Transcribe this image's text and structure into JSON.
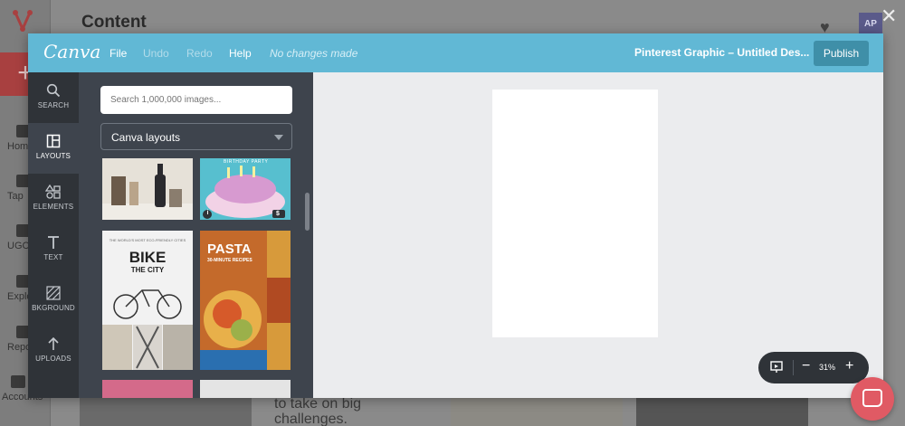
{
  "background": {
    "page_title": "Content",
    "avatar_initials": "AP",
    "nav": [
      "Home",
      "Tap",
      "UGC",
      "Explo",
      "Repo",
      "Accounts"
    ],
    "card_text": "to take on big challenges."
  },
  "editor": {
    "brand": "Canva",
    "menu": {
      "file": "File",
      "undo": "Undo",
      "redo": "Redo",
      "help": "Help"
    },
    "status": "No changes made",
    "doc_title": "Pinterest Graphic – Untitled Des...",
    "publish_label": "Publish",
    "sidebar": [
      {
        "label": "SEARCH",
        "icon": "search-icon"
      },
      {
        "label": "LAYOUTS",
        "icon": "layouts-icon",
        "active": true
      },
      {
        "label": "ELEMENTS",
        "icon": "elements-icon"
      },
      {
        "label": "TEXT",
        "icon": "text-icon"
      },
      {
        "label": "BKGROUND",
        "icon": "background-icon"
      },
      {
        "label": "UPLOADS",
        "icon": "upload-icon"
      }
    ],
    "search_placeholder": "Search 1,000,000 images...",
    "layout_select": "Canva layouts",
    "thumbnails": {
      "bike_kicker": "THE WORLD'S MOST ECO-FRIENDLY CITIES",
      "bike_title1": "BIKE",
      "bike_title2": "THE CITY",
      "pasta_title": "PASTA",
      "pasta_sub": "30-MINUTE RECIPES",
      "birthday_text": "BIRTHDAY PARTY",
      "price_badge": "$",
      "info_badge": "i"
    },
    "zoom": {
      "value": "31%",
      "minus": "−",
      "plus": "+"
    }
  }
}
